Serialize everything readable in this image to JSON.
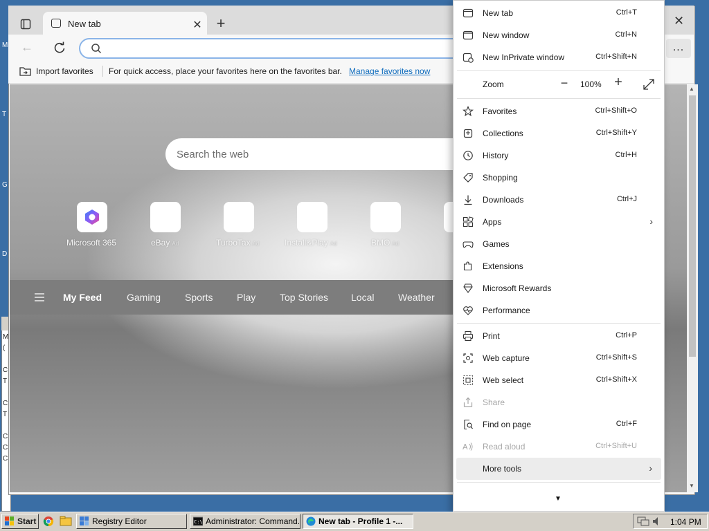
{
  "desktop": {
    "left_letters": [
      "M",
      "T",
      "G",
      "D"
    ],
    "bg_window_letters": [
      "M",
      "(",
      "C",
      "T",
      "C",
      "T",
      "C",
      "C",
      "C"
    ]
  },
  "browser": {
    "tab": {
      "title": "New tab",
      "close_icon": "close-icon",
      "new_tab_icon": "plus-icon"
    },
    "address_bar": {
      "value": "",
      "icon": "search-icon"
    },
    "favorites_bar": {
      "import_label": "Import favorites",
      "message": "For quick access, place your favorites here on the favorites bar.",
      "link": "Manage favorites now"
    },
    "more_button": "..."
  },
  "page": {
    "search_placeholder": "Search the web",
    "quick_links": [
      {
        "label": "Microsoft 365",
        "ad": ""
      },
      {
        "label": "eBay",
        "ad": "Ad"
      },
      {
        "label": "TurboTax",
        "ad": "Ad"
      },
      {
        "label": "Install&Play",
        "ad": "Ad"
      },
      {
        "label": "BMO",
        "ad": "Ad"
      }
    ],
    "feed_tabs": [
      "My Feed",
      "Gaming",
      "Sports",
      "Play",
      "Top Stories",
      "Local",
      "Weather"
    ]
  },
  "menu": {
    "items": [
      {
        "label": "New tab",
        "shortcut": "Ctrl+T",
        "icon": "new-tab-icon"
      },
      {
        "label": "New window",
        "shortcut": "Ctrl+N",
        "icon": "new-window-icon"
      },
      {
        "label": "New InPrivate window",
        "shortcut": "Ctrl+Shift+N",
        "icon": "inprivate-icon"
      },
      {
        "label": "Favorites",
        "shortcut": "Ctrl+Shift+O",
        "icon": "favorites-star-icon"
      },
      {
        "label": "Collections",
        "shortcut": "Ctrl+Shift+Y",
        "icon": "collections-icon"
      },
      {
        "label": "History",
        "shortcut": "Ctrl+H",
        "icon": "history-icon"
      },
      {
        "label": "Shopping",
        "shortcut": "",
        "icon": "shopping-tag-icon"
      },
      {
        "label": "Downloads",
        "shortcut": "Ctrl+J",
        "icon": "download-icon"
      },
      {
        "label": "Apps",
        "shortcut": "",
        "icon": "apps-icon"
      },
      {
        "label": "Games",
        "shortcut": "",
        "icon": "games-icon"
      },
      {
        "label": "Extensions",
        "shortcut": "",
        "icon": "extensions-icon"
      },
      {
        "label": "Microsoft Rewards",
        "shortcut": "",
        "icon": "rewards-icon"
      },
      {
        "label": "Performance",
        "shortcut": "",
        "icon": "performance-icon"
      },
      {
        "label": "Print",
        "shortcut": "Ctrl+P",
        "icon": "print-icon"
      },
      {
        "label": "Web capture",
        "shortcut": "Ctrl+Shift+S",
        "icon": "web-capture-icon"
      },
      {
        "label": "Web select",
        "shortcut": "Ctrl+Shift+X",
        "icon": "web-select-icon"
      },
      {
        "label": "Share",
        "shortcut": "",
        "icon": "share-icon"
      },
      {
        "label": "Find on page",
        "shortcut": "Ctrl+F",
        "icon": "find-icon"
      },
      {
        "label": "Read aloud",
        "shortcut": "Ctrl+Shift+U",
        "icon": "read-aloud-icon"
      },
      {
        "label": "More tools",
        "shortcut": "",
        "icon": "more-tools-icon"
      }
    ],
    "zoom": {
      "label": "Zoom",
      "value": "100%"
    }
  },
  "taskbar": {
    "start": "Start",
    "buttons": [
      {
        "label": "Registry Editor",
        "icon": "registry-editor-icon"
      },
      {
        "label": "Administrator:  Command...",
        "icon": "command-prompt-icon"
      },
      {
        "label": "New tab - Profile 1 -...",
        "icon": "edge-icon"
      }
    ],
    "time": "1:04 PM"
  },
  "colors": {
    "link": "#0f6cbd",
    "desktop": "#3a6ea5",
    "taskbar": "#d4d0c8",
    "address_focus": "#8ab4e8"
  }
}
